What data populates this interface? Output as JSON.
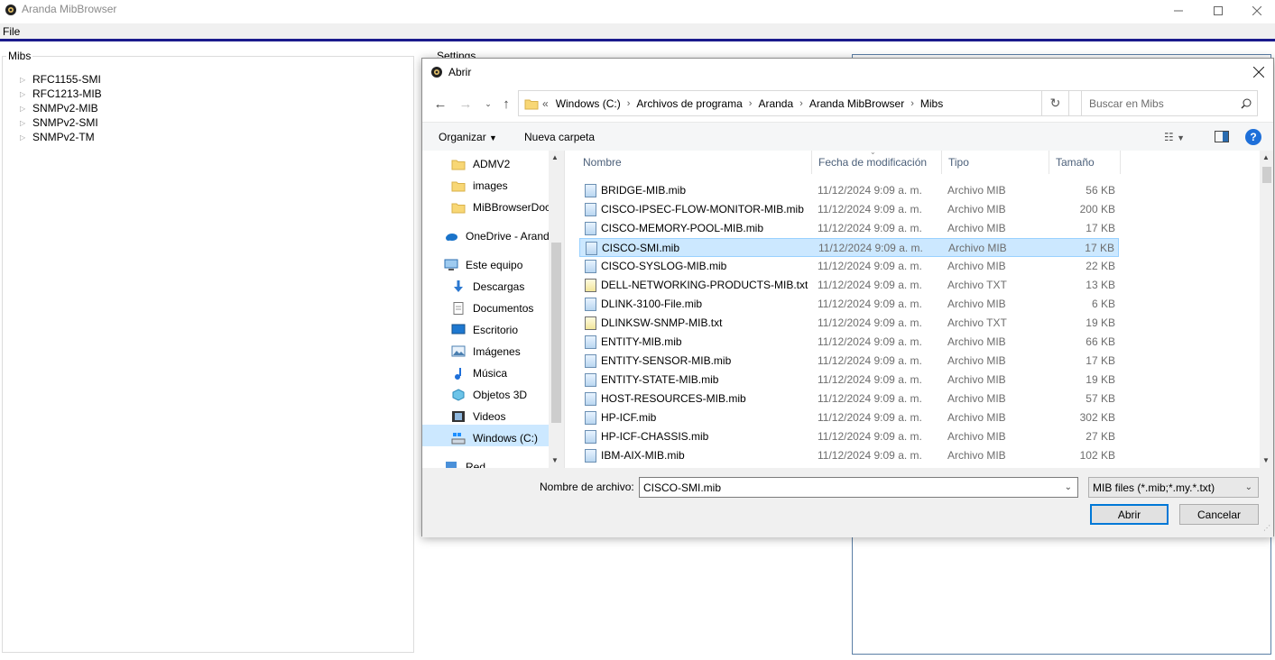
{
  "window": {
    "title": "Aranda MibBrowser",
    "menu": [
      "File"
    ]
  },
  "mibs": {
    "title": "Mibs",
    "items": [
      "RFC1155-SMI",
      "RFC1213-MIB",
      "SNMPv2-MIB",
      "SNMPv2-SMI",
      "SNMPv2-TM"
    ]
  },
  "settings": {
    "title": "Settings"
  },
  "dialog": {
    "title": "Abrir",
    "breadcrumb": [
      "«",
      "Windows (C:)",
      "Archivos de programa",
      "Aranda",
      "Aranda MibBrowser",
      "Mibs"
    ],
    "search_placeholder": "Buscar en Mibs",
    "organize": "Organizar",
    "new_folder": "Nueva carpeta",
    "nav": [
      {
        "label": "ADMV2",
        "icon": "folder-icon"
      },
      {
        "label": "images",
        "icon": "folder-icon"
      },
      {
        "label": "MiBBrowserDocu",
        "icon": "folder-icon"
      },
      {
        "label": "OneDrive - Aranda",
        "icon": "cloud-icon"
      },
      {
        "label": "Este equipo",
        "icon": "computer-icon"
      },
      {
        "label": "Descargas",
        "icon": "download-icon"
      },
      {
        "label": "Documentos",
        "icon": "document-icon"
      },
      {
        "label": "Escritorio",
        "icon": "desktop-icon"
      },
      {
        "label": "Imágenes",
        "icon": "pictures-icon"
      },
      {
        "label": "Música",
        "icon": "music-icon"
      },
      {
        "label": "Objetos 3D",
        "icon": "cube-icon"
      },
      {
        "label": "Videos",
        "icon": "video-icon"
      },
      {
        "label": "Windows  (C:)",
        "icon": "drive-icon"
      },
      {
        "label": "Red",
        "icon": "network-icon"
      }
    ],
    "columns": [
      "Nombre",
      "Fecha de modificación",
      "Tipo",
      "Tamaño"
    ],
    "files": [
      {
        "name": "BRIDGE-MIB.mib",
        "date": "11/12/2024 9:09 a. m.",
        "type": "Archivo MIB",
        "size": "56 KB"
      },
      {
        "name": "CISCO-IPSEC-FLOW-MONITOR-MIB.mib",
        "date": "11/12/2024 9:09 a. m.",
        "type": "Archivo MIB",
        "size": "200 KB"
      },
      {
        "name": "CISCO-MEMORY-POOL-MIB.mib",
        "date": "11/12/2024 9:09 a. m.",
        "type": "Archivo MIB",
        "size": "17 KB"
      },
      {
        "name": "CISCO-SMI.mib",
        "date": "11/12/2024 9:09 a. m.",
        "type": "Archivo MIB",
        "size": "17 KB"
      },
      {
        "name": "CISCO-SYSLOG-MIB.mib",
        "date": "11/12/2024 9:09 a. m.",
        "type": "Archivo MIB",
        "size": "22 KB"
      },
      {
        "name": "DELL-NETWORKING-PRODUCTS-MIB.txt",
        "date": "11/12/2024 9:09 a. m.",
        "type": "Archivo TXT",
        "size": "13 KB"
      },
      {
        "name": "DLINK-3100-File.mib",
        "date": "11/12/2024 9:09 a. m.",
        "type": "Archivo MIB",
        "size": "6 KB"
      },
      {
        "name": "DLINKSW-SNMP-MIB.txt",
        "date": "11/12/2024 9:09 a. m.",
        "type": "Archivo TXT",
        "size": "19 KB"
      },
      {
        "name": "ENTITY-MIB.mib",
        "date": "11/12/2024 9:09 a. m.",
        "type": "Archivo MIB",
        "size": "66 KB"
      },
      {
        "name": "ENTITY-SENSOR-MIB.mib",
        "date": "11/12/2024 9:09 a. m.",
        "type": "Archivo MIB",
        "size": "17 KB"
      },
      {
        "name": "ENTITY-STATE-MIB.mib",
        "date": "11/12/2024 9:09 a. m.",
        "type": "Archivo MIB",
        "size": "19 KB"
      },
      {
        "name": "HOST-RESOURCES-MIB.mib",
        "date": "11/12/2024 9:09 a. m.",
        "type": "Archivo MIB",
        "size": "57 KB"
      },
      {
        "name": "HP-ICF.mib",
        "date": "11/12/2024 9:09 a. m.",
        "type": "Archivo MIB",
        "size": "302 KB"
      },
      {
        "name": "HP-ICF-CHASSIS.mib",
        "date": "11/12/2024 9:09 a. m.",
        "type": "Archivo MIB",
        "size": "27 KB"
      },
      {
        "name": "IBM-AIX-MIB.mib",
        "date": "11/12/2024 9:09 a. m.",
        "type": "Archivo MIB",
        "size": "102 KB"
      }
    ],
    "selected_file": "CISCO-SMI.mib",
    "filename_label": "Nombre de archivo:",
    "filename_value": "CISCO-SMI.mib",
    "filter": "MIB files (*.mib;*.my.*.txt)",
    "open": "Abrir",
    "cancel": "Cancelar"
  },
  "colors": {
    "accent": "#0078d7",
    "selection": "#cce8ff",
    "menu_line": "#1a1a8c"
  }
}
